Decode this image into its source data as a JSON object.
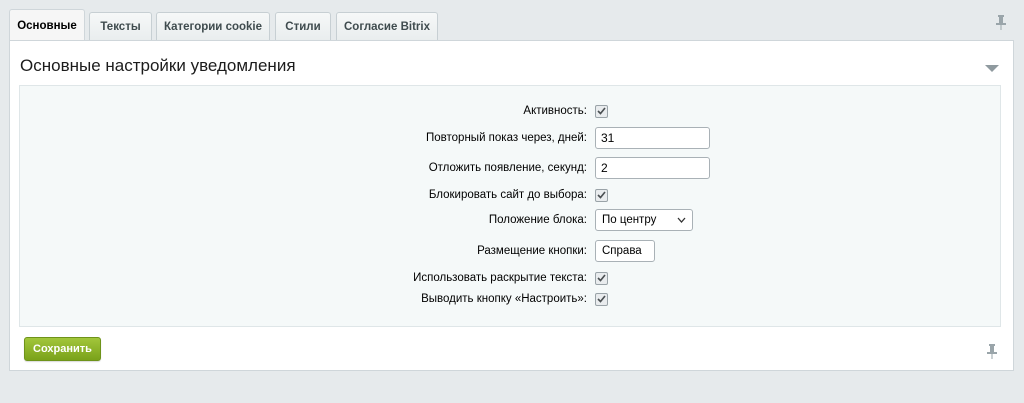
{
  "tabs": [
    {
      "label": "Основные",
      "active": true
    },
    {
      "label": "Тексты",
      "active": false
    },
    {
      "label": "Категории cookie",
      "active": false
    },
    {
      "label": "Стили",
      "active": false
    },
    {
      "label": "Согласие Bitrix",
      "active": false
    }
  ],
  "panel": {
    "title": "Основные настройки уведомления"
  },
  "form": {
    "active_label": "Активность:",
    "active_checked": true,
    "repeat_label": "Повторный показ через, дней:",
    "repeat_value": "31",
    "delay_label": "Отложить появление, секунд:",
    "delay_value": "2",
    "block_label": "Блокировать сайт до выбора:",
    "block_checked": true,
    "position_label": "Положение блока:",
    "position_value": "По центру",
    "button_place_label": "Размещение кнопки:",
    "button_place_value": "Справа",
    "expand_label": "Использовать раскрытие текста:",
    "expand_checked": true,
    "configure_label": "Выводить кнопку «Настроить»:",
    "configure_checked": true
  },
  "actions": {
    "save_label": "Сохранить"
  },
  "icons": {
    "pin": "pin-icon",
    "collapse": "triangle-down-icon",
    "checkmark": "checkmark-icon",
    "select_arrow": "chevron-down-icon"
  },
  "colors": {
    "save_button": "#8cb42a",
    "background": "#e6eaec",
    "form_area": "#f5f9f9"
  }
}
